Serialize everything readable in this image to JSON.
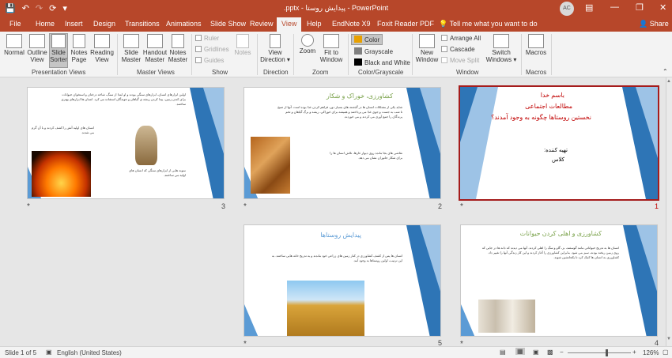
{
  "titlebar": {
    "title": ".pptx - پیدایش روستا - PowerPoint",
    "avatar": "AC",
    "quick_access": [
      "save-icon",
      "undo-icon",
      "redo-icon",
      "repeat-icon",
      "customize-icon"
    ]
  },
  "tabs": [
    "File",
    "Home",
    "Insert",
    "Design",
    "Transitions",
    "Animations",
    "Slide Show",
    "Review",
    "View",
    "Help",
    "EndNote X9",
    "Foxit Reader PDF"
  ],
  "active_tab": "View",
  "tell_me": "Tell me what you want to do",
  "share": "Share",
  "ribbon": {
    "presentation_views": {
      "label": "Presentation Views",
      "buttons": [
        {
          "line1": "Normal",
          "line2": ""
        },
        {
          "line1": "Outline",
          "line2": "View"
        },
        {
          "line1": "Slide",
          "line2": "Sorter"
        },
        {
          "line1": "Notes",
          "line2": "Page"
        },
        {
          "line1": "Reading",
          "line2": "View"
        }
      ]
    },
    "master_views": {
      "label": "Master Views",
      "buttons": [
        {
          "line1": "Slide",
          "line2": "Master"
        },
        {
          "line1": "Handout",
          "line2": "Master"
        },
        {
          "line1": "Notes",
          "line2": "Master"
        }
      ]
    },
    "show": {
      "label": "Show",
      "items": [
        "Ruler",
        "Gridlines",
        "Guides"
      ],
      "notes": "Notes"
    },
    "direction": {
      "label": "Direction",
      "line1": "View",
      "line2": "Direction ▾"
    },
    "zoom": {
      "label": "Zoom",
      "zoom": "Zoom",
      "fit_line1": "Fit to",
      "fit_line2": "Window"
    },
    "color": {
      "label": "Color/Grayscale",
      "items": [
        "Color",
        "Grayscale",
        "Black and White"
      ],
      "swatch_colors": [
        "#e8a000",
        "#808080",
        "#000000"
      ]
    },
    "window": {
      "label": "Window",
      "new_line1": "New",
      "new_line2": "Window",
      "items": [
        "Arrange All",
        "Cascade",
        "Move Split"
      ],
      "switch_line1": "Switch",
      "switch_line2": "Windows ▾"
    },
    "macros": {
      "label": "Macros",
      "button": "Macros"
    }
  },
  "slides": [
    {
      "number": "1",
      "marker": "*",
      "title_lines": [
        "باسم خدا",
        "مطالعات اجتماعی",
        "نخستین روستاها چگونه به وجود آمدند؟"
      ],
      "lines": [
        "تهیه کننده:",
        "کلاس"
      ]
    },
    {
      "number": "2",
      "marker": "*",
      "title": "کشاورزی، خوراک و شکار",
      "body": "شاید یکی از مشکلات انسان ها در گذشته های بسیار دور، فراهم کردن غذا بوده است. آنها از صبح تا شب به جست و جوی غذا می پرداختند و همیشه برای خوراکی، ریشه و برگ گیاهان و تخم پرندگان را جمع آوری می کردند و می خوردند.",
      "body2": "نقاشی های بجا مانده روی دیوار غارها، تلاش انسان ها را برای شکار جانوران نشان می دهد."
    },
    {
      "number": "3",
      "marker": "*",
      "body": "اولین ابزارهای انسان، ابزارهای سنگی بودند و او ابتدا از سنگ، شاخه درختان و استخوان حیوانات برای کندن زمین، پیدا کردن ریشه ی گیاهان و جوندگان استفاده می کرد. انسان ها ابزارهای بهتری ساختند.",
      "body2": "انسان های اولیه آتش را کشف کردند و با آن گرم می شدند.",
      "caption": "نمونه هایی از ابزارهای سنگی که انسان های اولیه می ساختند."
    },
    {
      "number": "4",
      "marker": "*",
      "title": "کشاورزی و اهلی کردن حیوانات",
      "body": "انسان ها به تدریج حیواناتی مانند گوسفند، بز، گاو و سگ را اهلی کردند. آنها می دیدند که دانه ها در جایی که روی زمین ریخته بودند، سبز می شود. بنابراین کشاورزی را آغاز کردند و این کار زندگی آنها را تغییر داد. کشاورزی به انسان ها کمک کرد تا یکجانشین شوند."
    },
    {
      "number": "5",
      "marker": "*",
      "title": "پیدایش روستاها",
      "body": "انسان ها پس از کشف کشاورزی در کنار زمین های زراعی خود ماندند و به تدریج خانه هایی ساختند. به این ترتیب، اولین روستاها به وجود آمد."
    }
  ],
  "status": {
    "slide": "Slide 1 of 5",
    "language": "English (United States)",
    "zoom": "126%"
  }
}
